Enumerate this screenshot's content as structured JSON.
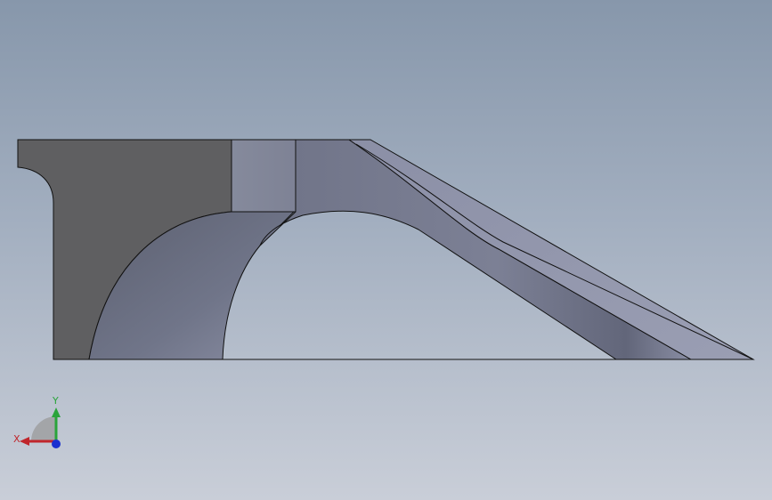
{
  "viewport": {
    "background_top": "#8797ab",
    "background_bottom": "#c9ced8"
  },
  "triad": {
    "x_label": "X",
    "y_label": "Y",
    "x_color": "#c0262c",
    "y_color": "#2aa43a",
    "z_color": "#1a2fd0"
  }
}
